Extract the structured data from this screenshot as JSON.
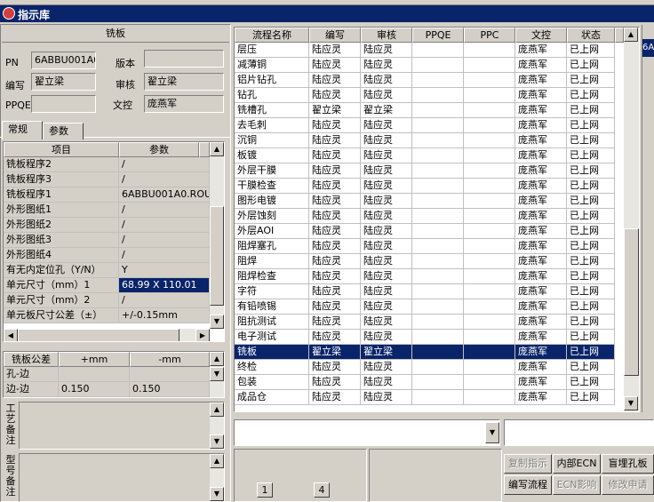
{
  "window": {
    "title": "指示库"
  },
  "left": {
    "header": "铣板",
    "pn_label": "PN",
    "pn_value": "6ABBU001A0",
    "version_label": "版本",
    "version_value": "",
    "writer_label": "编写",
    "writer_value": "翟立梁",
    "review_label": "审核",
    "review_value": "翟立梁",
    "ppqe_label": "PPQE",
    "ppqe_value": "",
    "doc_label": "文控",
    "doc_value": "庞燕军",
    "tabs": [
      "常规",
      "参数"
    ],
    "param_columns": [
      "项目",
      "参数"
    ],
    "params": [
      [
        "铣板程序2",
        "/"
      ],
      [
        "铣板程序3",
        "/"
      ],
      [
        "铣板程序1",
        "6ABBU001A0.ROU"
      ],
      [
        "外形图纸1",
        "/"
      ],
      [
        "外形图纸2",
        "/"
      ],
      [
        "外形图纸3",
        "/"
      ],
      [
        "外形图纸4",
        "/"
      ],
      [
        "有无内定位孔（Y/N）",
        "Y"
      ],
      [
        "单元尺寸（mm）1",
        "68.99 X 110.01"
      ],
      [
        "单元尺寸（mm）2",
        "/"
      ],
      [
        "单元板尺寸公差（±）",
        "+/-0.15mm"
      ]
    ],
    "tol_columns": [
      "铣板公差",
      "+mm",
      "-mm"
    ],
    "tol_rows": [
      [
        "孔-边",
        "",
        ""
      ],
      [
        "边-边",
        "0.150",
        "0.150"
      ]
    ],
    "craft_note_label": "工艺备注",
    "type_note_label": "型号备注"
  },
  "main": {
    "columns": [
      "流程名称",
      "编写",
      "审核",
      "PPQE",
      "PPC",
      "文控",
      "状态"
    ],
    "rows": [
      [
        "层压",
        "陆应灵",
        "陆应灵",
        "",
        "",
        "庞燕军",
        "已上网"
      ],
      [
        "减薄铜",
        "陆应灵",
        "陆应灵",
        "",
        "",
        "庞燕军",
        "已上网"
      ],
      [
        "铝片钻孔",
        "陆应灵",
        "陆应灵",
        "",
        "",
        "庞燕军",
        "已上网"
      ],
      [
        "钻孔",
        "陆应灵",
        "陆应灵",
        "",
        "",
        "庞燕军",
        "已上网"
      ],
      [
        "铣槽孔",
        "翟立梁",
        "翟立梁",
        "",
        "",
        "庞燕军",
        "已上网"
      ],
      [
        "去毛刺",
        "陆应灵",
        "陆应灵",
        "",
        "",
        "庞燕军",
        "已上网"
      ],
      [
        "沉铜",
        "陆应灵",
        "陆应灵",
        "",
        "",
        "庞燕军",
        "已上网"
      ],
      [
        "板镀",
        "陆应灵",
        "陆应灵",
        "",
        "",
        "庞燕军",
        "已上网"
      ],
      [
        "外层干膜",
        "陆应灵",
        "陆应灵",
        "",
        "",
        "庞燕军",
        "已上网"
      ],
      [
        "干膜检查",
        "陆应灵",
        "陆应灵",
        "",
        "",
        "庞燕军",
        "已上网"
      ],
      [
        "图形电镀",
        "陆应灵",
        "陆应灵",
        "",
        "",
        "庞燕军",
        "已上网"
      ],
      [
        "外层蚀刻",
        "陆应灵",
        "陆应灵",
        "",
        "",
        "庞燕军",
        "已上网"
      ],
      [
        "外层AOI",
        "陆应灵",
        "陆应灵",
        "",
        "",
        "庞燕军",
        "已上网"
      ],
      [
        "阻焊塞孔",
        "陆应灵",
        "陆应灵",
        "",
        "",
        "庞燕军",
        "已上网"
      ],
      [
        "阻焊",
        "陆应灵",
        "陆应灵",
        "",
        "",
        "庞燕军",
        "已上网"
      ],
      [
        "阻焊检查",
        "陆应灵",
        "陆应灵",
        "",
        "",
        "庞燕军",
        "已上网"
      ],
      [
        "字符",
        "陆应灵",
        "陆应灵",
        "",
        "",
        "庞燕军",
        "已上网"
      ],
      [
        "有铅喷锡",
        "陆应灵",
        "陆应灵",
        "",
        "",
        "庞燕军",
        "已上网"
      ],
      [
        "阻抗测试",
        "陆应灵",
        "陆应灵",
        "",
        "",
        "庞燕军",
        "已上网"
      ],
      [
        "电子测试",
        "陆应灵",
        "陆应灵",
        "",
        "",
        "庞燕军",
        "已上网"
      ],
      [
        "铣板",
        "翟立梁",
        "翟立梁",
        "",
        "",
        "庞燕军",
        "已上网"
      ],
      [
        "终检",
        "陆应灵",
        "陆应灵",
        "",
        "",
        "庞燕军",
        "已上网"
      ],
      [
        "包装",
        "陆应灵",
        "陆应灵",
        "",
        "",
        "庞燕军",
        "已上网"
      ],
      [
        "成品仓",
        "陆应灵",
        "陆应灵",
        "",
        "",
        "庞燕军",
        "已上网"
      ]
    ],
    "selected_row": 20,
    "right_stub": "6A"
  },
  "bottom": {
    "page_a": "1",
    "page_b": "4",
    "buttons_row1": [
      "复制指示",
      "内部ECN",
      "盲埋孔板"
    ],
    "buttons_row2": [
      "编写流程",
      "ECN影响",
      "修改申请"
    ]
  }
}
